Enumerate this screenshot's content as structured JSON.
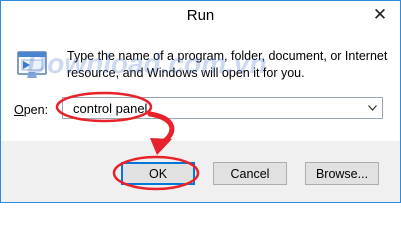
{
  "window": {
    "title": "Run"
  },
  "description": "Type the name of a program, folder, document, or Internet resource, and Windows will open it for you.",
  "open": {
    "label_accel": "O",
    "label_rest": "pen:",
    "value": "control panel"
  },
  "buttons": {
    "ok": "OK",
    "cancel": "Cancel",
    "browse": "Browse..."
  },
  "watermark": {
    "text": "Download.com.vn"
  },
  "colors": {
    "annotation_red": "#e8222a",
    "window_border": "#2b8be0",
    "focus_blue": "#0078d7"
  },
  "icons": {
    "close": "close-icon",
    "run": "run-app-icon",
    "dropdown": "chevron-down-icon"
  }
}
